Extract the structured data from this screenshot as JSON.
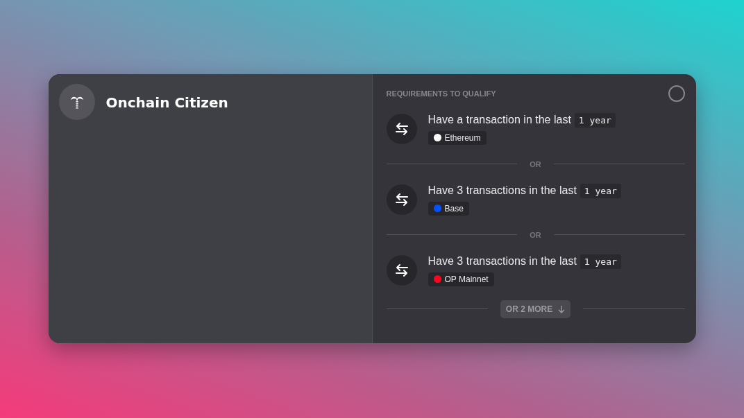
{
  "title": "Onchain Citizen",
  "requirements": {
    "heading": "REQUIREMENTS TO QUALIFY",
    "items": [
      {
        "text": "Have a transaction in the last",
        "period": "1 year",
        "chain": {
          "name": "Ethereum",
          "color": "#ffffff"
        }
      },
      {
        "separator": "OR",
        "text": "Have 3 transactions in the last",
        "period": "1 year",
        "chain": {
          "name": "Base",
          "color": "#0052ff"
        }
      },
      {
        "separator": "OR",
        "text": "Have 3 transactions in the last",
        "period": "1 year",
        "chain": {
          "name": "OP Mainnet",
          "color": "#ff0420"
        }
      }
    ],
    "more_button": "OR 2 MORE"
  }
}
